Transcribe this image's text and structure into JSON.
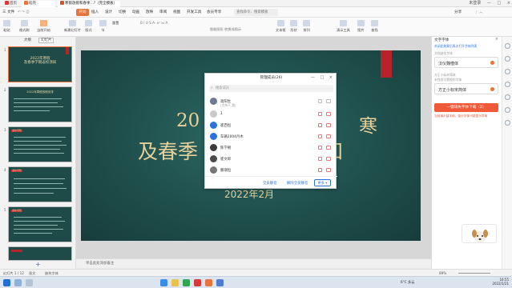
{
  "titlebar": {
    "tabs": [
      {
        "label": "首页"
      },
      {
        "label": "稻壳"
      },
      {
        "label": "寒假放假和春季...?（完全模板）"
      }
    ],
    "login": "未登录"
  },
  "menubar": {
    "items": [
      "三 文件",
      "开始",
      "插入",
      "设计",
      "切换",
      "动画",
      "放映",
      "审阅",
      "视图",
      "开发工具",
      "会员专享"
    ],
    "search": "查找命令、搜索模板",
    "right": [
      "分享"
    ]
  },
  "toolbar": {
    "tools": [
      "粘贴",
      "格式刷",
      "当前开始",
      "新建幻灯片",
      "版式",
      "节",
      "重置",
      "文本框",
      "形状",
      "排列",
      "演示工具",
      "图片",
      "查找"
    ],
    "font_size_label": "0",
    "extra": "智能图形 转换成图示"
  },
  "leftpanel": {
    "tabs": [
      "大纲",
      "幻灯片"
    ],
    "slides": [
      {
        "num": "1",
        "title": "2022年寒假\n及春季学期返校须知"
      },
      {
        "num": "2",
        "title": "2022年寒假放假安排"
      },
      {
        "num": "3",
        "title": "返校须知"
      },
      {
        "num": "4",
        "title": "返校须知"
      },
      {
        "num": "5",
        "title": "返校须知"
      }
    ],
    "add_label": "+"
  },
  "slide": {
    "line1_left": "20",
    "line1_right": "寒",
    "line2_left": "及春季",
    "line2_right": "知",
    "date": "2022年2月"
  },
  "notes": {
    "placeholder": "单击此处添加备注"
  },
  "dialog": {
    "title": "管理成员(26)",
    "controls": [
      "—",
      "□",
      "×"
    ],
    "search_placeholder": "搜索成员",
    "members": [
      {
        "name": "高阳生",
        "sub": "(主持人,我)"
      },
      {
        "name": "1",
        "sub": ""
      },
      {
        "name": "崔西恒",
        "sub": ""
      },
      {
        "name": "车辆2004丹木",
        "sub": ""
      },
      {
        "name": "陈学朝",
        "sub": ""
      },
      {
        "name": "崔文郎",
        "sub": ""
      },
      {
        "name": "鹏瑞恒",
        "sub": ""
      }
    ],
    "buttons": {
      "mute_all": "全员静音",
      "unmute_all": "解除全员静音",
      "more": "更多 ▾"
    }
  },
  "rightpanel": {
    "title": "文字字体",
    "link": "关闭此效果后再次打开字体列表",
    "section": "文档缺失字体",
    "fonts": [
      "汉仪魏楷体",
      "方正小标宋简体"
    ],
    "sub1": "方正小标宋简体",
    "sub2": "未找到可替换的字体",
    "download_label": "一键缺失字体下载（2）",
    "warning": "当前演示缺字体，部分字体可能显示异常"
  },
  "statusbar": {
    "slide_info": "幻灯片 1 / 12",
    "theme": "晋文",
    "font_missing": "缺失字体",
    "zoom": "89%"
  },
  "taskbar": {
    "weather": "6°C 多云",
    "time": "16:55",
    "date": "2022/1/21"
  },
  "colors": {
    "accent": "#e8743b",
    "slide_bg": "#1f4f4c",
    "slide_text": "#e6d19a",
    "red_bar": "#b8222a",
    "link": "#2a72e0"
  }
}
